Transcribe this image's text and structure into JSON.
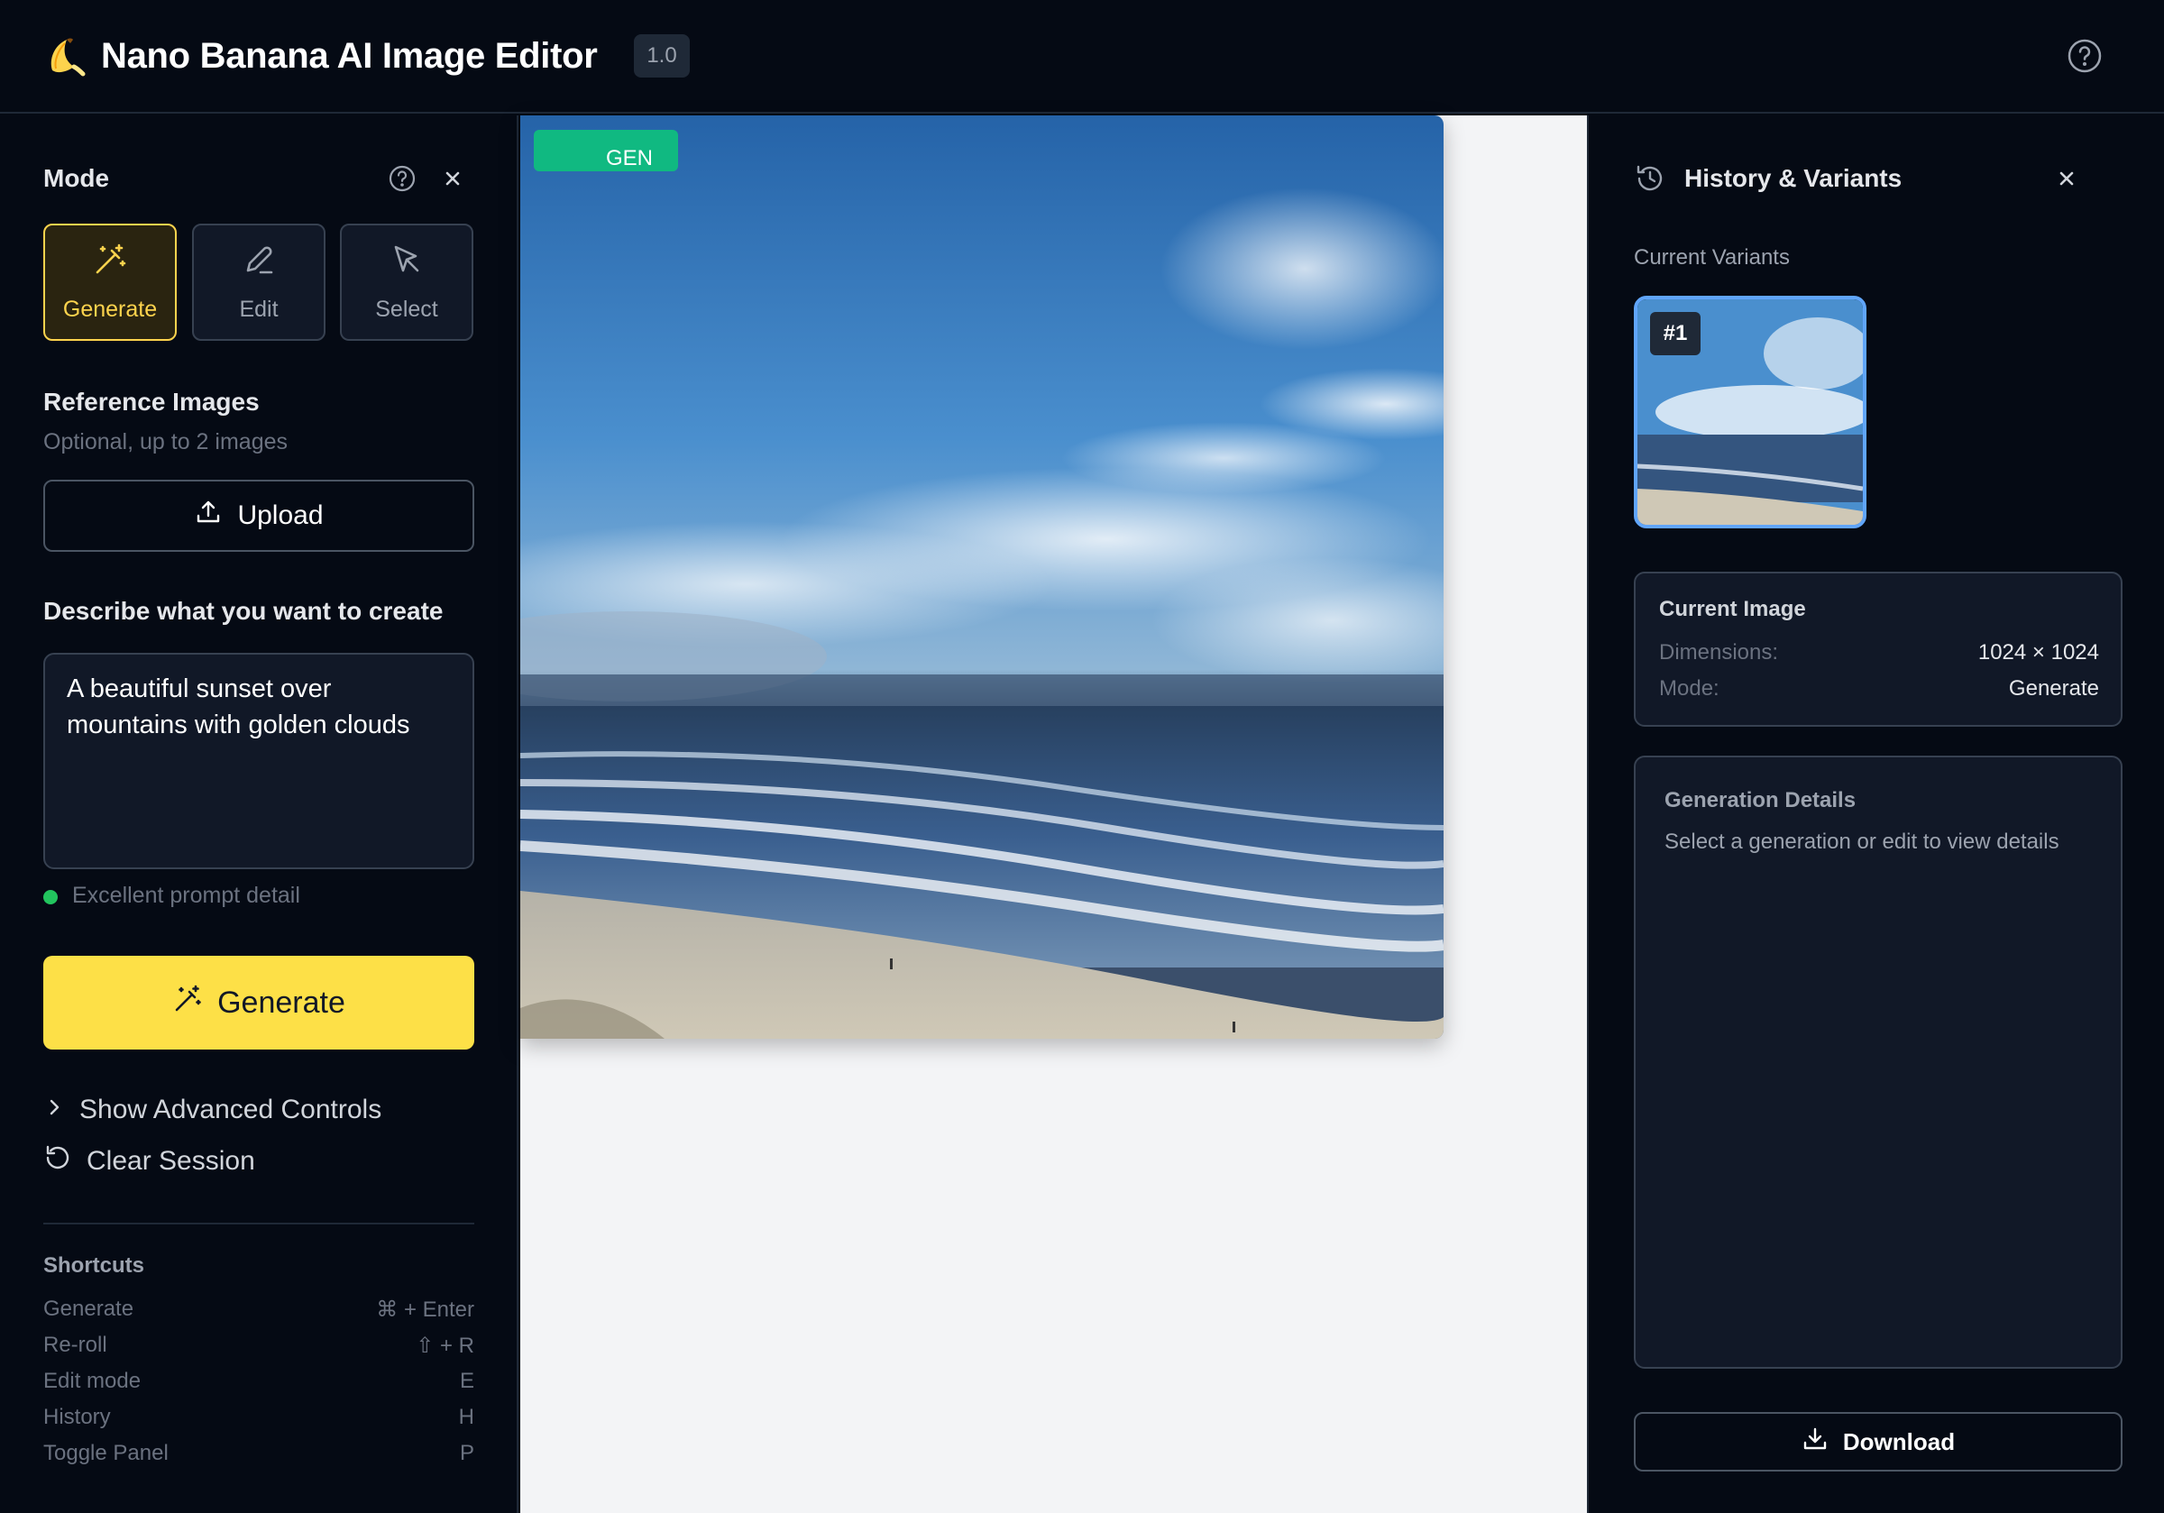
{
  "header": {
    "logo_icon": "banana-icon",
    "title": "Nano Banana AI Image Editor",
    "version": "1.0",
    "help_icon": "help-circle-icon"
  },
  "left_panel": {
    "mode_heading": "Mode",
    "modes": [
      {
        "label": "Generate",
        "icon": "magic-wand-icon",
        "active": true
      },
      {
        "label": "Edit",
        "icon": "pencil-icon",
        "active": false
      },
      {
        "label": "Select",
        "icon": "cursor-icon",
        "active": false
      }
    ],
    "reference": {
      "heading": "Reference Images",
      "subtitle": "Optional, up to 2 images",
      "upload_label": "Upload"
    },
    "prompt": {
      "heading": "Describe what you want to create",
      "value": "A beautiful sunset over mountains with golden clouds",
      "quality": "Excellent prompt detail"
    },
    "generate_label": "Generate",
    "advanced_label": "Show Advanced Controls",
    "clear_label": "Clear Session",
    "shortcuts": {
      "heading": "Shortcuts",
      "items": [
        {
          "action": "Generate",
          "keys": "⌘ + Enter"
        },
        {
          "action": "Re-roll",
          "keys": "⇧ + R"
        },
        {
          "action": "Edit mode",
          "keys": "E"
        },
        {
          "action": "History",
          "keys": "H"
        },
        {
          "action": "Toggle Panel",
          "keys": "P"
        }
      ]
    }
  },
  "canvas": {
    "badge": "GEN"
  },
  "right_panel": {
    "title": "History & Variants",
    "variants_heading": "Current Variants",
    "variant_label": "#1",
    "current_image": {
      "heading": "Current Image",
      "dimensions_label": "Dimensions:",
      "dimensions_value": "1024 × 1024",
      "mode_label": "Mode:",
      "mode_value": "Generate"
    },
    "generation_details": {
      "heading": "Generation Details",
      "text": "Select a generation or edit to view details"
    },
    "download_label": "Download"
  },
  "colors": {
    "background": "#050a14",
    "accent_yellow": "#fde047",
    "badge_green": "#10b981",
    "variant_border": "#60a5fa"
  }
}
